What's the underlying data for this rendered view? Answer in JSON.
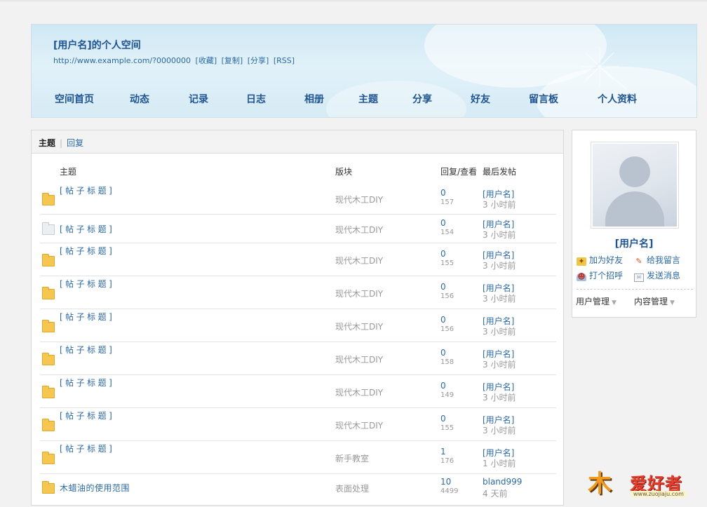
{
  "header": {
    "title": "[用户名]的个人空间",
    "url": "http://www.example.com/?0000000",
    "links": [
      "[收藏]",
      "[复制]",
      "[分享]",
      "[RSS]"
    ],
    "nav": [
      "空间首页",
      "动态",
      "记录",
      "日志",
      "相册",
      "主题",
      "分享",
      "好友",
      "留言板",
      "个人资料"
    ]
  },
  "tabs": {
    "active": "主题",
    "other": "回复"
  },
  "columns": {
    "topic": "主题",
    "board": "版块",
    "stats": "回复/查看",
    "last": "最后发帖"
  },
  "threads": [
    {
      "title": "[帖子标题]",
      "board": "现代木工DIY",
      "replies": "0",
      "views": "157",
      "author": "[用户名]",
      "time": "3 小时前",
      "icon": "folder-icon"
    },
    {
      "title": "[帖子标题]",
      "board": "现代木工DIY",
      "replies": "0",
      "views": "154",
      "author": "[用户名]",
      "time": "3 小时前",
      "icon": "document-icon"
    },
    {
      "title": "[帖子标题]",
      "board": "现代木工DIY",
      "replies": "0",
      "views": "155",
      "author": "[用户名]",
      "time": "3 小时前",
      "icon": "folder-icon"
    },
    {
      "title": "[帖子标题]",
      "board": "现代木工DIY",
      "replies": "0",
      "views": "156",
      "author": "[用户名]",
      "time": "3 小时前",
      "icon": "folder-icon"
    },
    {
      "title": "[帖子标题]",
      "board": "现代木工DIY",
      "replies": "0",
      "views": "156",
      "author": "[用户名]",
      "time": "3 小时前",
      "icon": "folder-icon"
    },
    {
      "title": "[帖子标题]",
      "board": "现代木工DIY",
      "replies": "0",
      "views": "158",
      "author": "[用户名]",
      "time": "3 小时前",
      "icon": "folder-icon"
    },
    {
      "title": "[帖子标题]",
      "board": "现代木工DIY",
      "replies": "0",
      "views": "149",
      "author": "[用户名]",
      "time": "3 小时前",
      "icon": "folder-icon"
    },
    {
      "title": "[帖子标题]",
      "board": "现代木工DIY",
      "replies": "0",
      "views": "155",
      "author": "[用户名]",
      "time": "3 小时前",
      "icon": "folder-icon"
    },
    {
      "title": "[帖子标题]",
      "board": "新手教室",
      "replies": "1",
      "views": "176",
      "author": "[用户名]",
      "time": "1 小时前",
      "icon": "folder-icon"
    },
    {
      "title": "木蜡油的使用范围",
      "board": "表面处理",
      "replies": "10",
      "views": "4499",
      "author": "bland999",
      "time": "4 天前",
      "icon": "folder-icon"
    }
  ],
  "profile": {
    "name": "[用户名]",
    "actions": [
      "加为好友",
      "给我留言",
      "打个招呼",
      "发送消息"
    ],
    "menus": [
      "用户管理",
      "内容管理"
    ]
  },
  "logo": {
    "text": "爱好者",
    "url": "www.zuojiaju.com"
  },
  "colors": {
    "link": "#2b6aa8",
    "title": "#1e5494",
    "folder": "#f6c750",
    "logo_red": "#e83d2b"
  }
}
